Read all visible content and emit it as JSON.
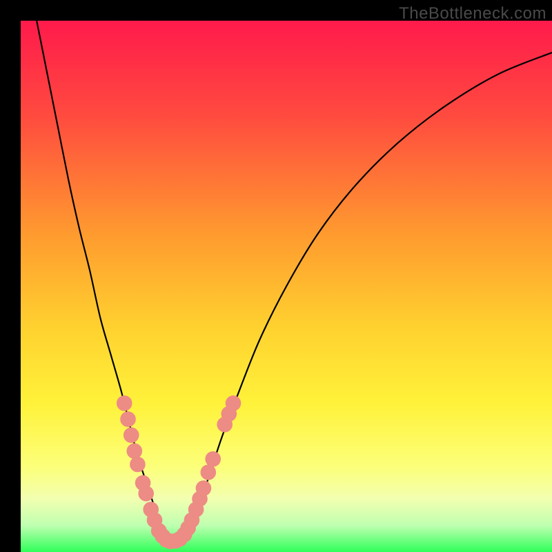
{
  "watermark": {
    "text": "TheBottleneck.com"
  },
  "colors": {
    "frame": "#000000",
    "curve": "#000000",
    "marker_fill": "#ed8b85",
    "marker_stroke": "#ed8b85",
    "gradient_stops": [
      {
        "pct": 0,
        "color": "#ff1a4b"
      },
      {
        "pct": 18,
        "color": "#ff4b3f"
      },
      {
        "pct": 40,
        "color": "#ff9a2f"
      },
      {
        "pct": 58,
        "color": "#ffd22f"
      },
      {
        "pct": 72,
        "color": "#fff23a"
      },
      {
        "pct": 84,
        "color": "#fcff7a"
      },
      {
        "pct": 90,
        "color": "#f2ffb0"
      },
      {
        "pct": 95,
        "color": "#bfffb0"
      },
      {
        "pct": 100,
        "color": "#2fff5a"
      }
    ]
  },
  "chart_data": {
    "type": "line",
    "title": "",
    "xlabel": "",
    "ylabel": "",
    "xlim": [
      0,
      100
    ],
    "ylim": [
      0,
      100
    ],
    "grid": false,
    "legend": false,
    "series": [
      {
        "name": "bottleneck-curve",
        "x": [
          3,
          5,
          7,
          9,
          11,
          13,
          15,
          17,
          19,
          21,
          22,
          23,
          24,
          25,
          26,
          27,
          28,
          29,
          30,
          31,
          32,
          34,
          36,
          38,
          41,
          45,
          50,
          56,
          63,
          71,
          80,
          90,
          100
        ],
        "y": [
          100,
          90,
          80,
          70,
          61,
          53,
          44,
          37,
          30,
          22,
          18,
          15,
          12,
          9,
          6,
          4,
          2.5,
          2,
          2,
          3,
          5,
          10,
          16,
          22,
          30,
          40,
          50,
          60,
          69,
          77,
          84,
          90,
          94
        ]
      }
    ],
    "markers": {
      "name": "highlighted-points",
      "points": [
        {
          "x": 19.5,
          "y": 28
        },
        {
          "x": 20.2,
          "y": 25
        },
        {
          "x": 20.8,
          "y": 22
        },
        {
          "x": 21.4,
          "y": 19
        },
        {
          "x": 22.0,
          "y": 16.5
        },
        {
          "x": 23.0,
          "y": 13
        },
        {
          "x": 23.6,
          "y": 11
        },
        {
          "x": 24.5,
          "y": 8
        },
        {
          "x": 25.2,
          "y": 6
        },
        {
          "x": 26.0,
          "y": 4
        },
        {
          "x": 26.7,
          "y": 3
        },
        {
          "x": 27.4,
          "y": 2.3
        },
        {
          "x": 28.2,
          "y": 2
        },
        {
          "x": 29.2,
          "y": 2.1
        },
        {
          "x": 30.0,
          "y": 2.5
        },
        {
          "x": 30.8,
          "y": 3.3
        },
        {
          "x": 31.5,
          "y": 4.5
        },
        {
          "x": 32.2,
          "y": 6
        },
        {
          "x": 33.0,
          "y": 8
        },
        {
          "x": 33.7,
          "y": 10
        },
        {
          "x": 34.4,
          "y": 12
        },
        {
          "x": 35.3,
          "y": 15
        },
        {
          "x": 36.2,
          "y": 17.5
        },
        {
          "x": 38.4,
          "y": 24
        },
        {
          "x": 39.2,
          "y": 26
        },
        {
          "x": 40.0,
          "y": 28
        }
      ],
      "radius_data_units": 1.4
    }
  }
}
